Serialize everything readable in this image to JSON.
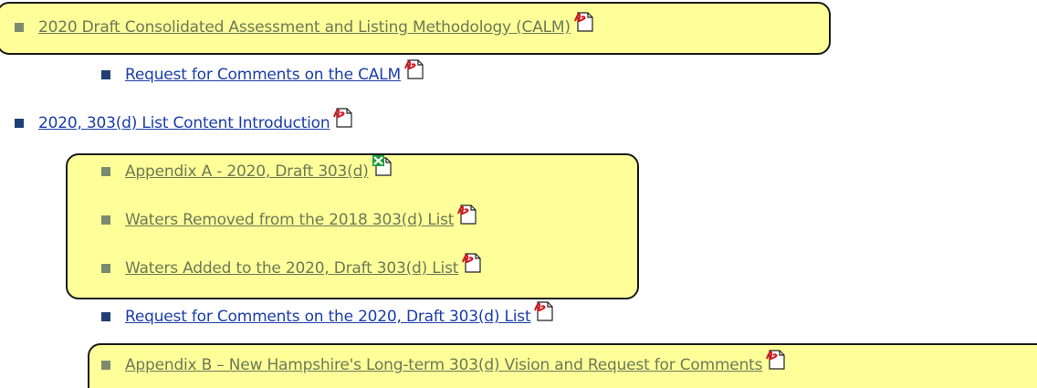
{
  "items": [
    {
      "label": "2020 Draft Consolidated Assessment and Listing Methodology (CALM)",
      "icon": "pdf-icon",
      "visited": true
    },
    {
      "label": "Request for Comments on the CALM",
      "icon": "pdf-icon",
      "visited": false
    },
    {
      "label": "2020, 303(d) List Content Introduction",
      "icon": "pdf-icon",
      "visited": false
    },
    {
      "label": "Appendix A - 2020, Draft 303(d)",
      "icon": "excel-icon",
      "visited": true
    },
    {
      "label": "Waters Removed from the 2018 303(d) List",
      "icon": "pdf-icon",
      "visited": true
    },
    {
      "label": "Waters Added to the 2020, Draft 303(d) List",
      "icon": "pdf-icon",
      "visited": true
    },
    {
      "label": "Request for Comments on the 2020, Draft 303(d) List",
      "icon": "pdf-icon",
      "visited": false
    },
    {
      "label": "Appendix B – New Hampshire's Long-term 303(d) Vision and Request for Comments",
      "icon": "pdf-icon",
      "visited": true
    }
  ],
  "colors": {
    "highlight": "#ffff99",
    "link_unvisited": "#1a3da8",
    "link_visited": "#6b7a57",
    "bullet_navy": "#1f3f74",
    "bullet_green": "#7c8b6f",
    "pdf_red": "#d8141c",
    "excel_green": "#1e9e3a"
  }
}
